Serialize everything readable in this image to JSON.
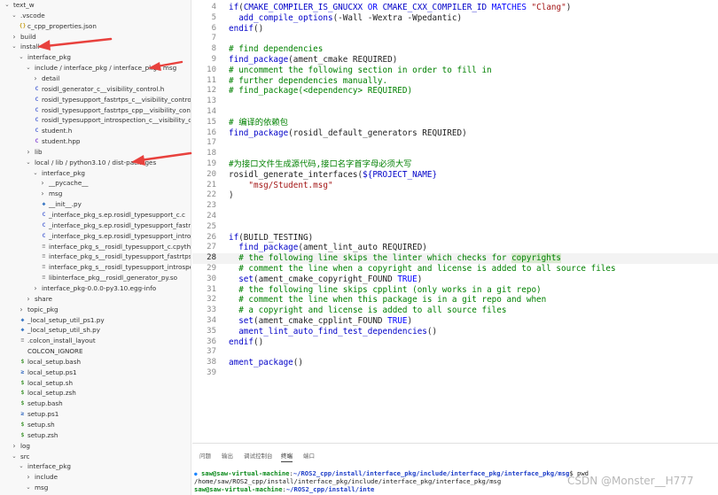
{
  "explorer": {
    "items": [
      {
        "label": "text_w",
        "depth": 0,
        "kind": "folder-open"
      },
      {
        "label": ".vscode",
        "depth": 1,
        "kind": "folder-open"
      },
      {
        "label": "c_cpp_properties.json",
        "depth": 2,
        "kind": "json"
      },
      {
        "label": "build",
        "depth": 1,
        "kind": "folder-closed"
      },
      {
        "label": "install",
        "depth": 1,
        "kind": "folder-open"
      },
      {
        "label": "interface_pkg",
        "depth": 2,
        "kind": "folder-open"
      },
      {
        "label": "include / interface_pkg / interface_pkg / msg",
        "depth": 3,
        "kind": "folder-open"
      },
      {
        "label": "detail",
        "depth": 4,
        "kind": "folder-closed"
      },
      {
        "label": "rosidl_generator_c__visibility_control.h",
        "depth": 4,
        "kind": "c"
      },
      {
        "label": "rosidl_typesupport_fastrtps_c__visibility_control.h",
        "depth": 4,
        "kind": "c"
      },
      {
        "label": "rosidl_typesupport_fastrtps_cpp__visibility_control.h",
        "depth": 4,
        "kind": "c"
      },
      {
        "label": "rosidl_typesupport_introspection_c__visibility_control.h",
        "depth": 4,
        "kind": "c"
      },
      {
        "label": "student.h",
        "depth": 4,
        "kind": "c"
      },
      {
        "label": "student.hpp",
        "depth": 4,
        "kind": "cpp"
      },
      {
        "label": "lib",
        "depth": 3,
        "kind": "folder-closed"
      },
      {
        "label": "local / lib / python3.10 / dist-packages",
        "depth": 3,
        "kind": "folder-open"
      },
      {
        "label": "interface_pkg",
        "depth": 4,
        "kind": "folder-open"
      },
      {
        "label": "__pycache__",
        "depth": 5,
        "kind": "folder-closed"
      },
      {
        "label": "msg",
        "depth": 5,
        "kind": "folder-closed"
      },
      {
        "label": "__init__.py",
        "depth": 5,
        "kind": "py"
      },
      {
        "label": "_interface_pkg_s.ep.rosidl_typesupport_c.c",
        "depth": 5,
        "kind": "c"
      },
      {
        "label": "_interface_pkg_s.ep.rosidl_typesupport_fastrtps_c.c",
        "depth": 5,
        "kind": "c"
      },
      {
        "label": "_interface_pkg_s.ep.rosidl_typesupport_introspection...",
        "depth": 5,
        "kind": "c"
      },
      {
        "label": "interface_pkg_s__rosidl_typesupport_c.cpython-310-x...",
        "depth": 5,
        "kind": "bin"
      },
      {
        "label": "interface_pkg_s__rosidl_typesupport_fastrtps_c.cpyth...",
        "depth": 5,
        "kind": "bin"
      },
      {
        "label": "interface_pkg_s__rosidl_typesupport_introspection_c...",
        "depth": 5,
        "kind": "bin"
      },
      {
        "label": "libinterface_pkg__rosidl_generator_py.so",
        "depth": 5,
        "kind": "bin"
      },
      {
        "label": "interface_pkg-0.0.0-py3.10.egg-info",
        "depth": 4,
        "kind": "folder-closed"
      },
      {
        "label": "share",
        "depth": 3,
        "kind": "folder-closed"
      },
      {
        "label": "topic_pkg",
        "depth": 2,
        "kind": "folder-closed"
      },
      {
        "label": "_local_setup_util_ps1.py",
        "depth": 2,
        "kind": "py"
      },
      {
        "label": "_local_setup_util_sh.py",
        "depth": 2,
        "kind": "py"
      },
      {
        "label": ".colcon_install_layout",
        "depth": 2,
        "kind": "bin"
      },
      {
        "label": "COLCON_IGNORE",
        "depth": 2,
        "kind": "none"
      },
      {
        "label": "local_setup.bash",
        "depth": 2,
        "kind": "sh"
      },
      {
        "label": "local_setup.ps1",
        "depth": 2,
        "kind": "ps"
      },
      {
        "label": "local_setup.sh",
        "depth": 2,
        "kind": "sh"
      },
      {
        "label": "local_setup.zsh",
        "depth": 2,
        "kind": "sh"
      },
      {
        "label": "setup.bash",
        "depth": 2,
        "kind": "sh"
      },
      {
        "label": "setup.ps1",
        "depth": 2,
        "kind": "ps"
      },
      {
        "label": "setup.sh",
        "depth": 2,
        "kind": "sh"
      },
      {
        "label": "setup.zsh",
        "depth": 2,
        "kind": "sh"
      },
      {
        "label": "log",
        "depth": 1,
        "kind": "folder-closed"
      },
      {
        "label": "src",
        "depth": 1,
        "kind": "folder-open"
      },
      {
        "label": "interface_pkg",
        "depth": 2,
        "kind": "folder-open"
      },
      {
        "label": "include",
        "depth": 3,
        "kind": "folder-closed"
      },
      {
        "label": "msg",
        "depth": 3,
        "kind": "folder-open"
      },
      {
        "label": "Student.msg",
        "depth": 4,
        "kind": "msg"
      }
    ]
  },
  "editor": {
    "first_line_number": 4,
    "active_line": 28,
    "lines": [
      [
        [
          "tk-fn",
          "if"
        ],
        [
          "tk-plain",
          "("
        ],
        [
          "tk-var",
          "CMAKE_COMPILER_IS_GNUCXX"
        ],
        [
          "tk-plain",
          " "
        ],
        [
          "tk-kw",
          "OR"
        ],
        [
          "tk-plain",
          " "
        ],
        [
          "tk-var",
          "CMAKE_CXX_COMPILER_ID"
        ],
        [
          "tk-plain",
          " "
        ],
        [
          "tk-kw",
          "MATCHES"
        ],
        [
          "tk-plain",
          " "
        ],
        [
          "tk-str",
          "\"Clang\""
        ],
        [
          "tk-plain",
          ")"
        ]
      ],
      [
        [
          "tk-plain",
          "  "
        ],
        [
          "tk-fn",
          "add_compile_options"
        ],
        [
          "tk-plain",
          "(-Wall -Wextra -Wpedantic)"
        ]
      ],
      [
        [
          "tk-fn",
          "endif"
        ],
        [
          "tk-plain",
          "()"
        ]
      ],
      [],
      [
        [
          "tk-cm",
          "# find dependencies"
        ]
      ],
      [
        [
          "tk-fn",
          "find_package"
        ],
        [
          "tk-plain",
          "(ament_cmake REQUIRED)"
        ]
      ],
      [
        [
          "tk-cm",
          "# uncomment the following section in order to fill in"
        ]
      ],
      [
        [
          "tk-cm",
          "# further dependencies manually."
        ]
      ],
      [
        [
          "tk-cm",
          "# find_package(<dependency> REQUIRED)"
        ]
      ],
      [],
      [],
      [
        [
          "tk-cm",
          "# 编译的依赖包"
        ]
      ],
      [
        [
          "tk-fn",
          "find_package"
        ],
        [
          "tk-plain",
          "(rosidl_default_generators REQUIRED)"
        ]
      ],
      [],
      [],
      [
        [
          "tk-cm",
          "#为接口文件生成源代码,接口名字首字母必须大写"
        ]
      ],
      [
        [
          "tk-plain",
          "rosidl_generate_interfaces("
        ],
        [
          "tk-var",
          "${PROJECT_NAME}"
        ]
      ],
      [
        [
          "tk-plain",
          "    "
        ],
        [
          "tk-str",
          "\"msg/Student.msg\""
        ]
      ],
      [
        [
          "tk-plain",
          ")"
        ]
      ],
      [],
      [],
      [],
      [
        [
          "tk-fn",
          "if"
        ],
        [
          "tk-plain",
          "(BUILD_TESTING)"
        ]
      ],
      [
        [
          "tk-plain",
          "  "
        ],
        [
          "tk-fn",
          "find_package"
        ],
        [
          "tk-plain",
          "(ament_lint_auto REQUIRED)"
        ]
      ],
      [
        [
          "tk-plain",
          "  "
        ],
        [
          "tk-cm",
          "# the following line skips the linter which checks for "
        ],
        [
          "tk-cm tk-hl",
          "copyrights"
        ]
      ],
      [
        [
          "tk-plain",
          "  "
        ],
        [
          "tk-cm",
          "# comment the line when a copyright and license is added to all source files"
        ]
      ],
      [
        [
          "tk-plain",
          "  "
        ],
        [
          "tk-fn",
          "set"
        ],
        [
          "tk-plain",
          "(ament_cmake_copyright_FOUND "
        ],
        [
          "tk-kw",
          "TRUE"
        ],
        [
          "tk-plain",
          ")"
        ]
      ],
      [
        [
          "tk-plain",
          "  "
        ],
        [
          "tk-cm",
          "# the following line skips cpplint (only works in a git repo)"
        ]
      ],
      [
        [
          "tk-plain",
          "  "
        ],
        [
          "tk-cm",
          "# comment the line when this package is in a git repo and when"
        ]
      ],
      [
        [
          "tk-plain",
          "  "
        ],
        [
          "tk-cm",
          "# a copyright and license is added to all source files"
        ]
      ],
      [
        [
          "tk-plain",
          "  "
        ],
        [
          "tk-fn",
          "set"
        ],
        [
          "tk-plain",
          "(ament_cmake_cpplint_FOUND "
        ],
        [
          "tk-kw",
          "TRUE"
        ],
        [
          "tk-plain",
          ")"
        ]
      ],
      [
        [
          "tk-plain",
          "  "
        ],
        [
          "tk-fn",
          "ament_lint_auto_find_test_dependencies"
        ],
        [
          "tk-plain",
          "()"
        ]
      ],
      [
        [
          "tk-fn",
          "endif"
        ],
        [
          "tk-plain",
          "()"
        ]
      ],
      [],
      [
        [
          "tk-fn",
          "ament_package"
        ],
        [
          "tk-plain",
          "()"
        ]
      ],
      []
    ]
  },
  "panel": {
    "tabs": [
      "问题",
      "输出",
      "调试控制台",
      "终端",
      "端口"
    ],
    "active_tab": 3,
    "terminal": {
      "line1_user": "saw@saw-virtual-machine",
      "line1_path": "~/ROS2_cpp/install/interface_pkg/include/interface_pkg/interface_pkg/msg",
      "line1_cmd": "$ pwd",
      "line2": "/home/saw/ROS2_cpp/install/interface_pkg/include/interface_pkg/interface_pkg/msg",
      "line3_user": "saw@saw-virtual-machine",
      "line3_path": "~/ROS2_cpp/install/inte"
    }
  },
  "watermark": "CSDN @Monster__H777",
  "colors": {
    "annotation_arrow": "#e8413d",
    "keyword": "#0000ff",
    "comment": "#008000",
    "string": "#a31515"
  }
}
